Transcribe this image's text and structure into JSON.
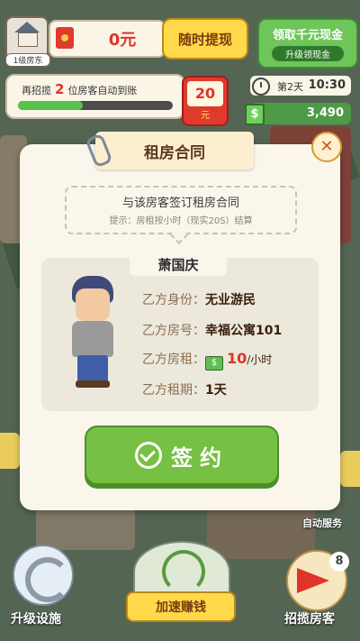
{
  "hud": {
    "house_level": "1级房东",
    "cash": "0元",
    "withdraw_label": "随时提现",
    "claim_title": "领取千元现金",
    "claim_sub": "升级领现金",
    "recruit_prefix": "再招揽",
    "recruit_needed": "2",
    "recruit_suffix": "位房客自动到账",
    "recruit_progress": 0.42,
    "reward_amount": "20",
    "reward_unit": "元",
    "day": "第2天",
    "time": "10:30",
    "money": "3,490"
  },
  "dialog": {
    "title": "租房合同",
    "close_glyph": "✕",
    "prompt": "与该房客签订租房合同",
    "hint": "提示：房租按小时（现实20S）结算",
    "tenant_name": "萧国庆",
    "fields": {
      "identity_label": "乙方身份：",
      "identity_value": "无业游民",
      "room_label": "乙方房号：",
      "room_value": "幸福公寓101",
      "rent_label": "乙方房租：",
      "rent_value": "10",
      "rent_unit": "/小时",
      "term_label": "乙方租期：",
      "term_value": "1天"
    },
    "sign_label": "签约"
  },
  "bottom": {
    "upgrade_label": "升级设施",
    "speed_label": "加速赚钱",
    "recruit_label": "招揽房客",
    "recruit_count": "8",
    "auto_label": "自动服务"
  },
  "colors": {
    "accent_green": "#76c043",
    "accent_red": "#e0332a",
    "accent_yellow": "#ffd94a"
  }
}
